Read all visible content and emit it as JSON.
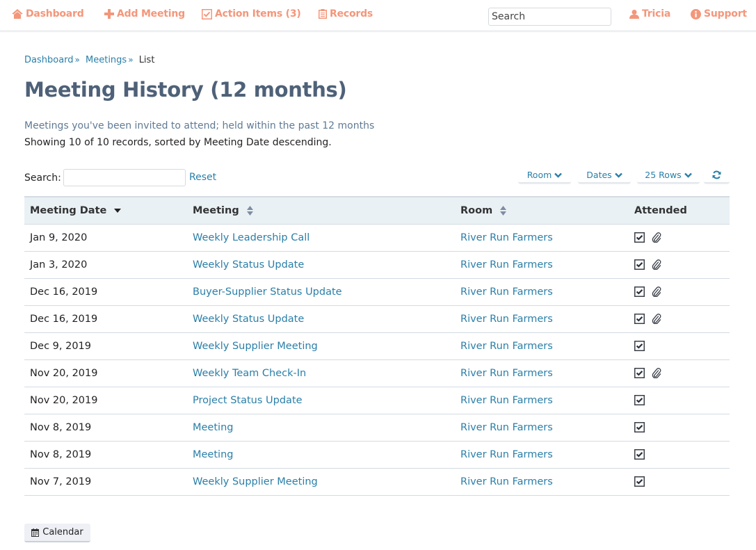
{
  "nav": {
    "dashboard": "Dashboard",
    "add_meeting": "Add Meeting",
    "action_items": "Action Items (3)",
    "records": "Records",
    "search_placeholder": "Search",
    "user": "Tricia",
    "support": "Support"
  },
  "breadcrumb": {
    "items": [
      "Dashboard",
      "Meetings"
    ],
    "separator": "»",
    "current": "List"
  },
  "page": {
    "title": "Meeting History (12 months)",
    "subtitle": "Meetings you've been invited to attend; held within the past 12 months",
    "summary": "Showing 10 of 10 records, sorted by Meeting Date descending."
  },
  "search": {
    "label": "Search:",
    "value": "",
    "reset": "Reset"
  },
  "filters": {
    "room": "Room",
    "dates": "Dates",
    "rows": "25 Rows"
  },
  "table": {
    "headers": {
      "date": "Meeting Date",
      "meeting": "Meeting",
      "room": "Room",
      "attended": "Attended"
    },
    "sort": {
      "column": "Meeting Date",
      "direction": "descending"
    },
    "rows": [
      {
        "date": "Jan 9, 2020",
        "meeting": "Weekly Leadership Call",
        "room": "River Run Farmers",
        "attended": true,
        "attachment": true
      },
      {
        "date": "Jan 3, 2020",
        "meeting": "Weekly Status Update",
        "room": "River Run Farmers",
        "attended": true,
        "attachment": true
      },
      {
        "date": "Dec 16, 2019",
        "meeting": "Buyer-Supplier Status Update",
        "room": "River Run Farmers",
        "attended": true,
        "attachment": true
      },
      {
        "date": "Dec 16, 2019",
        "meeting": "Weekly Status Update",
        "room": "River Run Farmers",
        "attended": true,
        "attachment": true
      },
      {
        "date": "Dec 9, 2019",
        "meeting": "Weekly Supplier Meeting",
        "room": "River Run Farmers",
        "attended": true,
        "attachment": false
      },
      {
        "date": "Nov 20, 2019",
        "meeting": "Weekly Team Check-In",
        "room": "River Run Farmers",
        "attended": true,
        "attachment": true
      },
      {
        "date": "Nov 20, 2019",
        "meeting": "Project Status Update",
        "room": "River Run Farmers",
        "attended": true,
        "attachment": false
      },
      {
        "date": "Nov 8, 2019",
        "meeting": "Meeting",
        "room": "River Run Farmers",
        "attended": true,
        "attachment": false
      },
      {
        "date": "Nov 8, 2019",
        "meeting": "Meeting",
        "room": "River Run Farmers",
        "attended": true,
        "attachment": false
      },
      {
        "date": "Nov 7, 2019",
        "meeting": "Weekly Supplier Meeting",
        "room": "River Run Farmers",
        "attended": true,
        "attachment": false
      }
    ]
  },
  "footer": {
    "calendar": "Calendar"
  },
  "icons": {
    "dashboard": "home-icon",
    "add_meeting": "plus-icon",
    "action_items": "checkbox-icon",
    "records": "clipboard-icon",
    "user": "user-icon",
    "support": "info-circle-icon",
    "refresh": "refresh-icon",
    "calendar": "calendar-icon",
    "attended": "checked-box-icon",
    "attachment": "paperclip-icon"
  },
  "colors": {
    "nav_accent": "#f4967a",
    "link": "#2a7fa8",
    "title": "#4e6178",
    "header_bg": "#eaf1f5"
  }
}
